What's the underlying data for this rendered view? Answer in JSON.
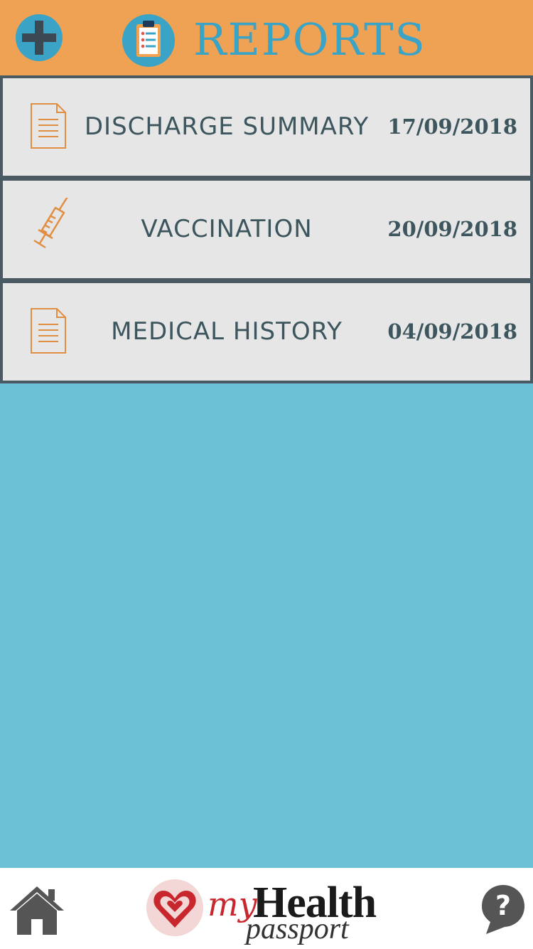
{
  "header": {
    "title": "REPORTS",
    "add_icon": "plus-icon",
    "title_icon": "clipboard-icon",
    "colors": {
      "bar": "#f0a254",
      "accent": "#3aa3c6"
    }
  },
  "reports": [
    {
      "icon": "document-icon",
      "label": "DISCHARGE SUMMARY",
      "date": "17/09/2018"
    },
    {
      "icon": "syringe-icon",
      "label": "VACCINATION",
      "date": "20/09/2018"
    },
    {
      "icon": "document-icon",
      "label": "MEDICAL HISTORY",
      "date": "04/09/2018"
    }
  ],
  "footer": {
    "home_icon": "home-icon",
    "help_icon": "help-bubble-icon",
    "logo": {
      "my": "my",
      "health": "Health",
      "passport": "passport"
    }
  },
  "colors": {
    "background": "#6cc1d7",
    "row_bg": "#e6e6e6",
    "row_border": "#4a5a62",
    "text": "#3d565e"
  }
}
